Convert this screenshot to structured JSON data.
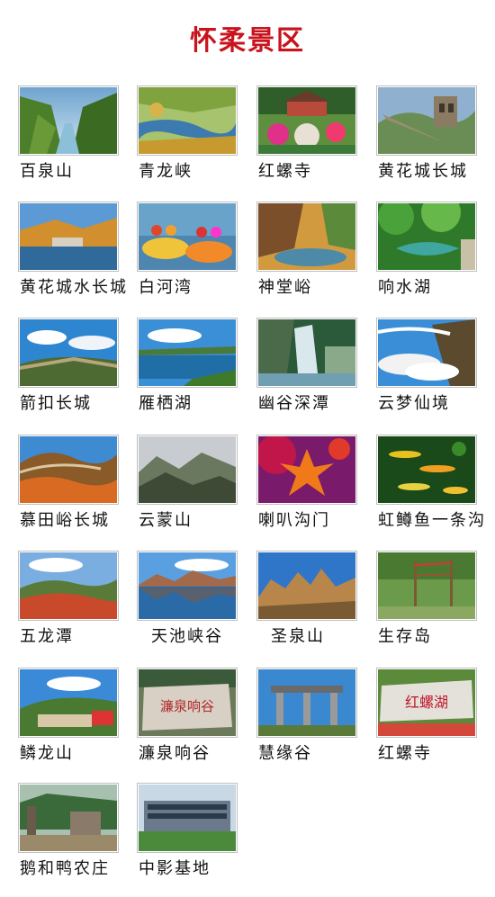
{
  "page": {
    "title": "怀柔景区"
  },
  "spots": [
    {
      "name": "百泉山",
      "scene": "gorge"
    },
    {
      "name": "青龙峡",
      "scene": "lakeyellow"
    },
    {
      "name": "红螺寺",
      "scene": "temple"
    },
    {
      "name": "黄花城长城",
      "scene": "wall"
    },
    {
      "name": "黄花城水长城",
      "scene": "dam"
    },
    {
      "name": "白河湾",
      "scene": "raft"
    },
    {
      "name": "神堂峪",
      "scene": "canyon"
    },
    {
      "name": "响水湖",
      "scene": "green"
    },
    {
      "name": "箭扣长城",
      "scene": "skywall"
    },
    {
      "name": "雁栖湖",
      "scene": "bluelake"
    },
    {
      "name": "幽谷深潭",
      "scene": "waterfall"
    },
    {
      "name": "云梦仙境",
      "scene": "clouds"
    },
    {
      "name": "慕田峪长城",
      "scene": "autumnwall"
    },
    {
      "name": "云蒙山",
      "scene": "mountains"
    },
    {
      "name": "喇叭沟门",
      "scene": "mapleleaf"
    },
    {
      "name": "虹鳟鱼一条沟",
      "scene": "fish"
    },
    {
      "name": "五龙潭",
      "scene": "redhills"
    },
    {
      "name": "天池峡谷",
      "scene": "mirrorlake"
    },
    {
      "name": "圣泉山",
      "scene": "rocks"
    },
    {
      "name": "生存岛",
      "scene": "ropes"
    },
    {
      "name": "鳞龙山",
      "scene": "village"
    },
    {
      "name": "濂泉响谷",
      "scene": "stone"
    },
    {
      "name": "慧缘谷",
      "scene": "archway"
    },
    {
      "name": "红螺寺",
      "scene": "redstone"
    },
    {
      "name": "鹅和鸭农庄",
      "scene": "farm"
    },
    {
      "name": "中影基地",
      "scene": "building"
    }
  ],
  "stone_texts": {
    "stone": "濂泉响谷",
    "redstone": "红螺湖"
  }
}
